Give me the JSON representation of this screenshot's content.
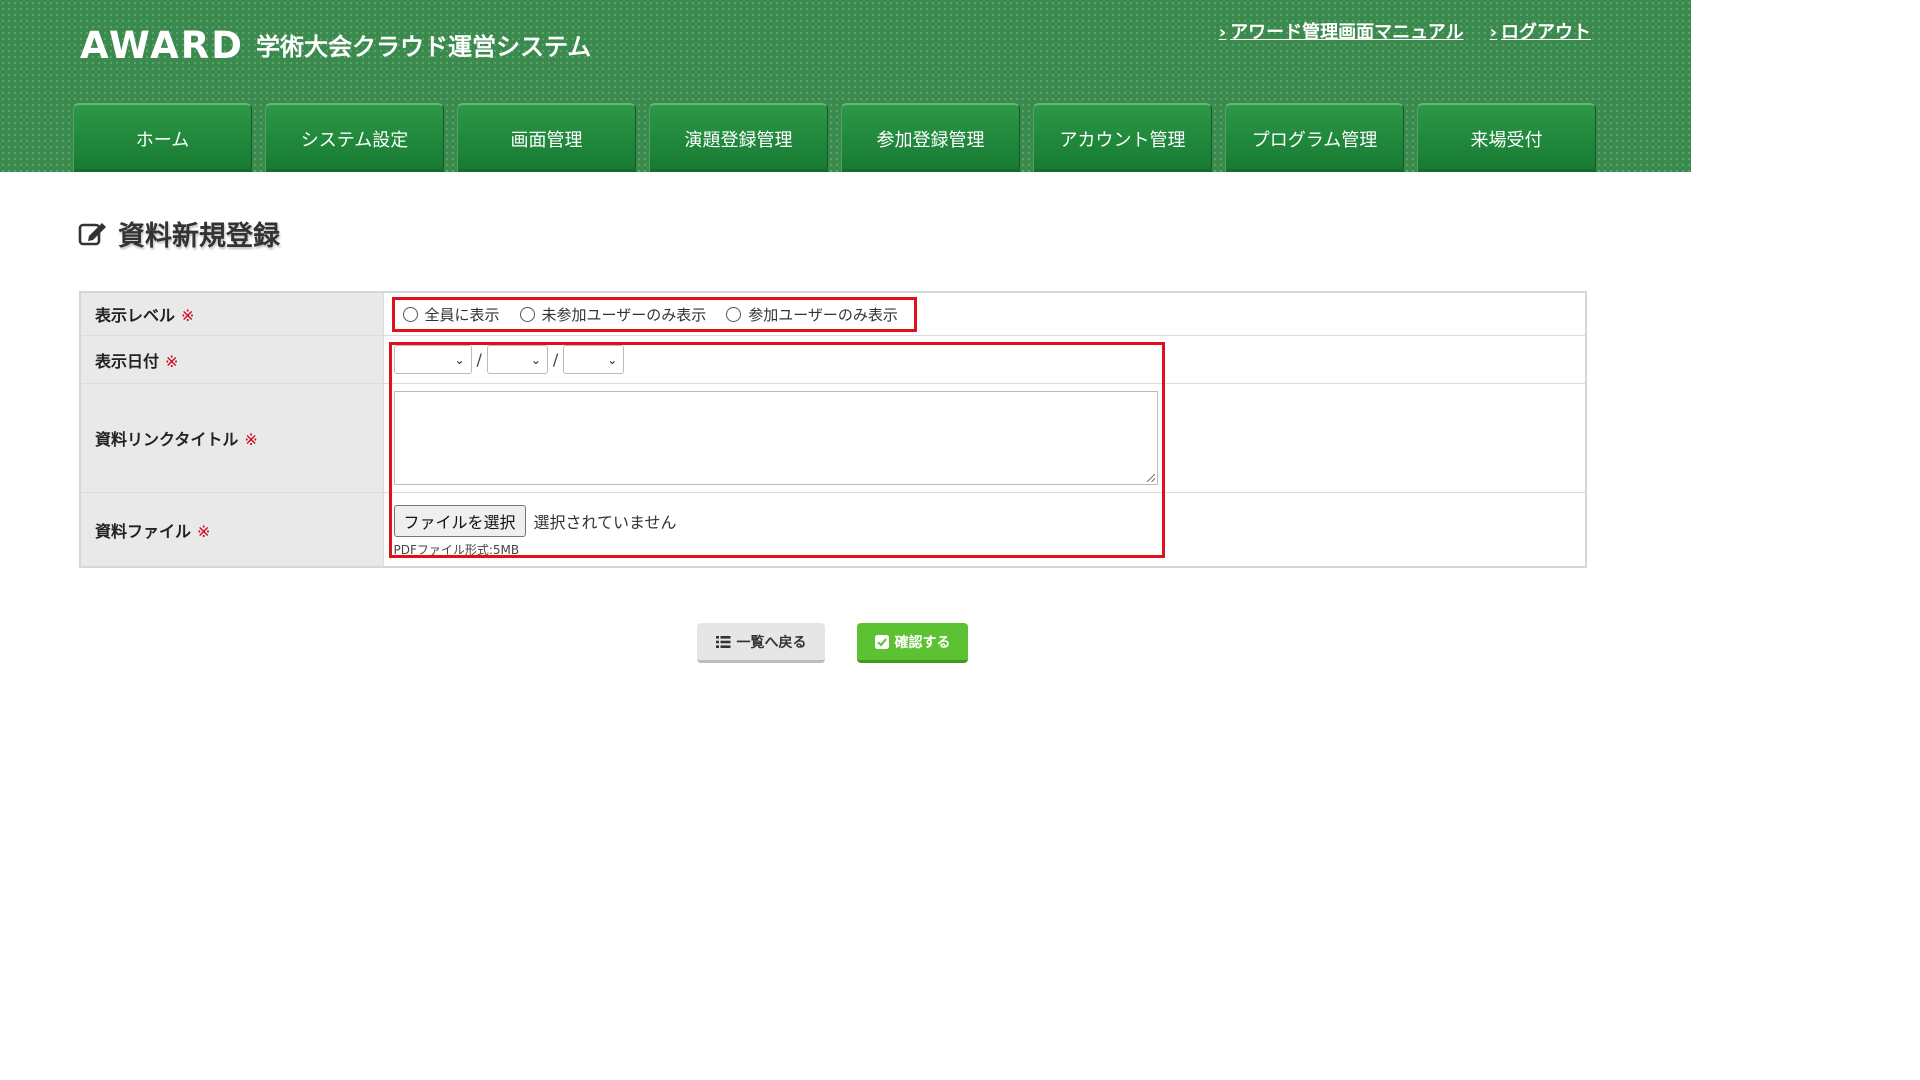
{
  "header": {
    "logo": "AWARD",
    "system_name": "学術大会クラウド運営システム",
    "links": [
      {
        "label": "アワード管理画面マニュアル"
      },
      {
        "label": "ログアウト"
      }
    ],
    "nav": [
      {
        "label": "ホーム"
      },
      {
        "label": "システム設定"
      },
      {
        "label": "画面管理"
      },
      {
        "label": "演題登録管理"
      },
      {
        "label": "参加登録管理"
      },
      {
        "label": "アカウント管理"
      },
      {
        "label": "プログラム管理"
      },
      {
        "label": "来場受付"
      }
    ],
    "colors": {
      "header_bg": "#3a8a4e",
      "tab_bg": "#1f8a3c"
    }
  },
  "page": {
    "title": "資料新規登録",
    "title_icon": "edit-icon"
  },
  "form": {
    "required_mark": "※",
    "rows": {
      "display_level": {
        "label": "表示レベル",
        "options": [
          "全員に表示",
          "未参加ユーザーのみ表示",
          "参加ユーザーのみ表示"
        ]
      },
      "display_date": {
        "label": "表示日付",
        "separator": "/",
        "year": "",
        "month": "",
        "day": ""
      },
      "link_title": {
        "label": "資料リンクタイトル",
        "value": ""
      },
      "file": {
        "label": "資料ファイル",
        "button": "ファイルを選択",
        "status": "選択されていません",
        "note": "PDFファイル形式:5MB"
      }
    },
    "highlight_color": "#e0101d"
  },
  "actions": {
    "back_label": "一覧へ戻る",
    "back_icon": "list-icon",
    "confirm_label": "確認する",
    "confirm_icon": "check-square-icon",
    "confirm_color": "#5cc233"
  }
}
